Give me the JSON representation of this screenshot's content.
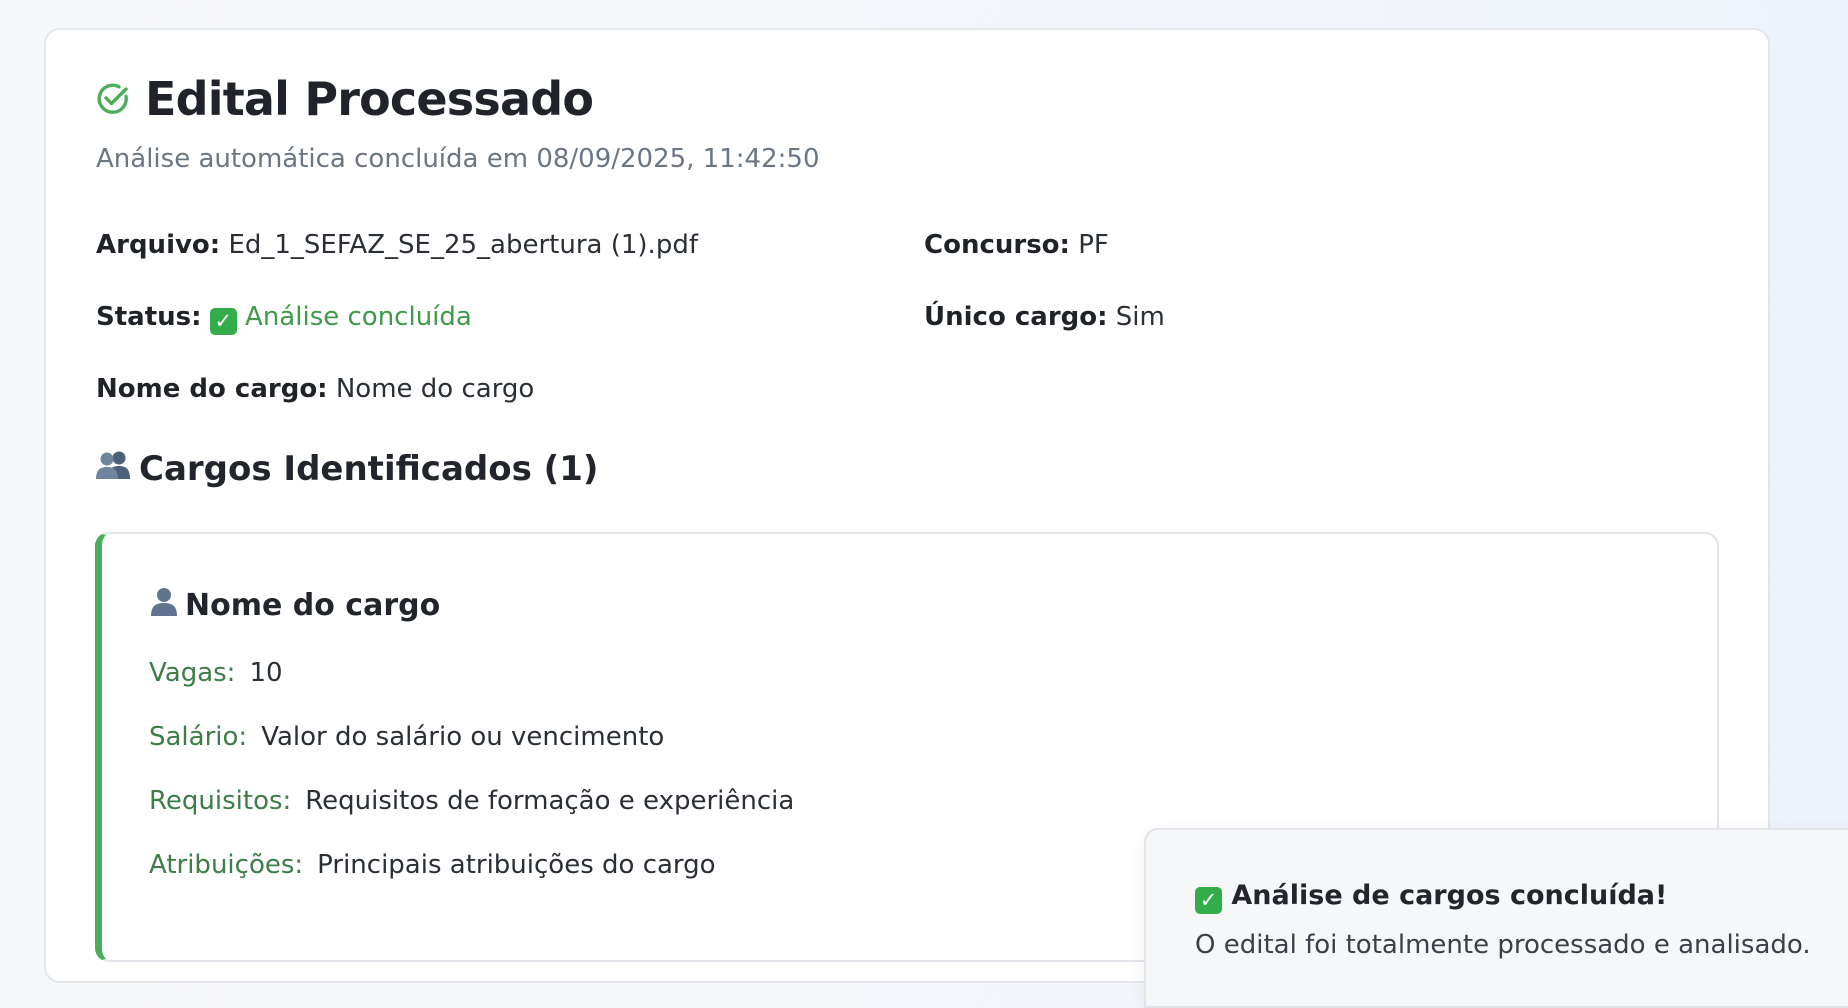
{
  "header": {
    "title": "Edital Processado",
    "subtitle": "Análise automática concluída em 08/09/2025, 11:42:50"
  },
  "details": {
    "file_label": "Arquivo:",
    "file_value": "Ed_1_SEFAZ_SE_25_abertura (1).pdf",
    "contest_label": "Concurso:",
    "contest_value": "PF",
    "status_label": "Status:",
    "status_value": "Análise concluída",
    "single_label": "Único cargo:",
    "single_value": "Sim",
    "position_label": "Nome do cargo:",
    "position_value": "Nome do cargo"
  },
  "section": {
    "title": "Cargos Identificados (1)"
  },
  "job": {
    "title": "Nome do cargo",
    "fields": [
      {
        "label": "Vagas:",
        "value": "10"
      },
      {
        "label": "Salário:",
        "value": "Valor do salário ou vencimento"
      },
      {
        "label": "Requisitos:",
        "value": "Requisitos de formação e experiência"
      },
      {
        "label": "Atribuições:",
        "value": "Principais atribuições do cargo"
      }
    ]
  },
  "toast": {
    "title": "Análise de cargos concluída!",
    "message": "O edital foi totalmente processado e analisado."
  },
  "colors": {
    "success": "#4cae5a",
    "label_green": "#3d7d47",
    "muted": "#6b7684"
  },
  "icons": {
    "title": "check-circle-icon",
    "section": "busts-in-silhouette-icon",
    "job": "bust-in-silhouette-icon",
    "status": "check-mark-button-icon"
  }
}
